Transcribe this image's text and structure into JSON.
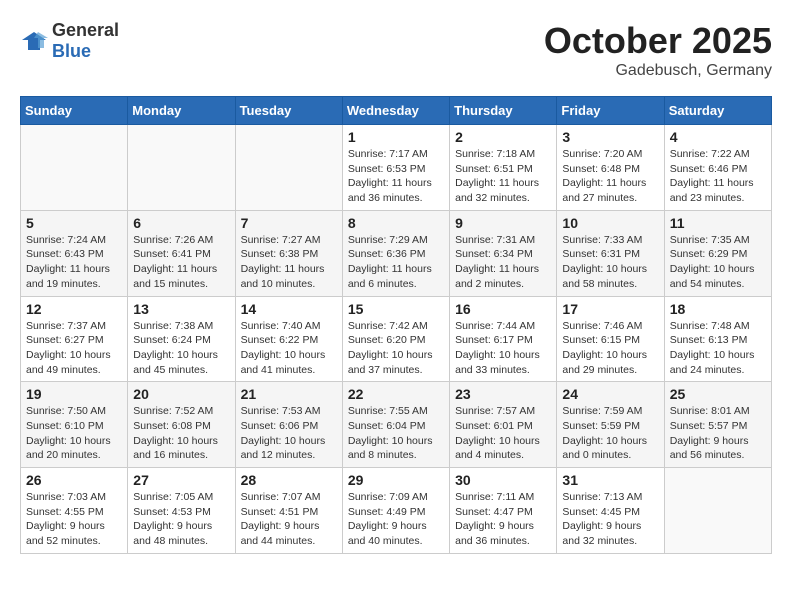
{
  "logo": {
    "text_general": "General",
    "text_blue": "Blue"
  },
  "header": {
    "month": "October 2025",
    "location": "Gadebusch, Germany"
  },
  "weekdays": [
    "Sunday",
    "Monday",
    "Tuesday",
    "Wednesday",
    "Thursday",
    "Friday",
    "Saturday"
  ],
  "weeks": [
    [
      {
        "day": "",
        "info": ""
      },
      {
        "day": "",
        "info": ""
      },
      {
        "day": "",
        "info": ""
      },
      {
        "day": "1",
        "info": "Sunrise: 7:17 AM\nSunset: 6:53 PM\nDaylight: 11 hours\nand 36 minutes."
      },
      {
        "day": "2",
        "info": "Sunrise: 7:18 AM\nSunset: 6:51 PM\nDaylight: 11 hours\nand 32 minutes."
      },
      {
        "day": "3",
        "info": "Sunrise: 7:20 AM\nSunset: 6:48 PM\nDaylight: 11 hours\nand 27 minutes."
      },
      {
        "day": "4",
        "info": "Sunrise: 7:22 AM\nSunset: 6:46 PM\nDaylight: 11 hours\nand 23 minutes."
      }
    ],
    [
      {
        "day": "5",
        "info": "Sunrise: 7:24 AM\nSunset: 6:43 PM\nDaylight: 11 hours\nand 19 minutes."
      },
      {
        "day": "6",
        "info": "Sunrise: 7:26 AM\nSunset: 6:41 PM\nDaylight: 11 hours\nand 15 minutes."
      },
      {
        "day": "7",
        "info": "Sunrise: 7:27 AM\nSunset: 6:38 PM\nDaylight: 11 hours\nand 10 minutes."
      },
      {
        "day": "8",
        "info": "Sunrise: 7:29 AM\nSunset: 6:36 PM\nDaylight: 11 hours\nand 6 minutes."
      },
      {
        "day": "9",
        "info": "Sunrise: 7:31 AM\nSunset: 6:34 PM\nDaylight: 11 hours\nand 2 minutes."
      },
      {
        "day": "10",
        "info": "Sunrise: 7:33 AM\nSunset: 6:31 PM\nDaylight: 10 hours\nand 58 minutes."
      },
      {
        "day": "11",
        "info": "Sunrise: 7:35 AM\nSunset: 6:29 PM\nDaylight: 10 hours\nand 54 minutes."
      }
    ],
    [
      {
        "day": "12",
        "info": "Sunrise: 7:37 AM\nSunset: 6:27 PM\nDaylight: 10 hours\nand 49 minutes."
      },
      {
        "day": "13",
        "info": "Sunrise: 7:38 AM\nSunset: 6:24 PM\nDaylight: 10 hours\nand 45 minutes."
      },
      {
        "day": "14",
        "info": "Sunrise: 7:40 AM\nSunset: 6:22 PM\nDaylight: 10 hours\nand 41 minutes."
      },
      {
        "day": "15",
        "info": "Sunrise: 7:42 AM\nSunset: 6:20 PM\nDaylight: 10 hours\nand 37 minutes."
      },
      {
        "day": "16",
        "info": "Sunrise: 7:44 AM\nSunset: 6:17 PM\nDaylight: 10 hours\nand 33 minutes."
      },
      {
        "day": "17",
        "info": "Sunrise: 7:46 AM\nSunset: 6:15 PM\nDaylight: 10 hours\nand 29 minutes."
      },
      {
        "day": "18",
        "info": "Sunrise: 7:48 AM\nSunset: 6:13 PM\nDaylight: 10 hours\nand 24 minutes."
      }
    ],
    [
      {
        "day": "19",
        "info": "Sunrise: 7:50 AM\nSunset: 6:10 PM\nDaylight: 10 hours\nand 20 minutes."
      },
      {
        "day": "20",
        "info": "Sunrise: 7:52 AM\nSunset: 6:08 PM\nDaylight: 10 hours\nand 16 minutes."
      },
      {
        "day": "21",
        "info": "Sunrise: 7:53 AM\nSunset: 6:06 PM\nDaylight: 10 hours\nand 12 minutes."
      },
      {
        "day": "22",
        "info": "Sunrise: 7:55 AM\nSunset: 6:04 PM\nDaylight: 10 hours\nand 8 minutes."
      },
      {
        "day": "23",
        "info": "Sunrise: 7:57 AM\nSunset: 6:01 PM\nDaylight: 10 hours\nand 4 minutes."
      },
      {
        "day": "24",
        "info": "Sunrise: 7:59 AM\nSunset: 5:59 PM\nDaylight: 10 hours\nand 0 minutes."
      },
      {
        "day": "25",
        "info": "Sunrise: 8:01 AM\nSunset: 5:57 PM\nDaylight: 9 hours\nand 56 minutes."
      }
    ],
    [
      {
        "day": "26",
        "info": "Sunrise: 7:03 AM\nSunset: 4:55 PM\nDaylight: 9 hours\nand 52 minutes."
      },
      {
        "day": "27",
        "info": "Sunrise: 7:05 AM\nSunset: 4:53 PM\nDaylight: 9 hours\nand 48 minutes."
      },
      {
        "day": "28",
        "info": "Sunrise: 7:07 AM\nSunset: 4:51 PM\nDaylight: 9 hours\nand 44 minutes."
      },
      {
        "day": "29",
        "info": "Sunrise: 7:09 AM\nSunset: 4:49 PM\nDaylight: 9 hours\nand 40 minutes."
      },
      {
        "day": "30",
        "info": "Sunrise: 7:11 AM\nSunset: 4:47 PM\nDaylight: 9 hours\nand 36 minutes."
      },
      {
        "day": "31",
        "info": "Sunrise: 7:13 AM\nSunset: 4:45 PM\nDaylight: 9 hours\nand 32 minutes."
      },
      {
        "day": "",
        "info": ""
      }
    ]
  ]
}
